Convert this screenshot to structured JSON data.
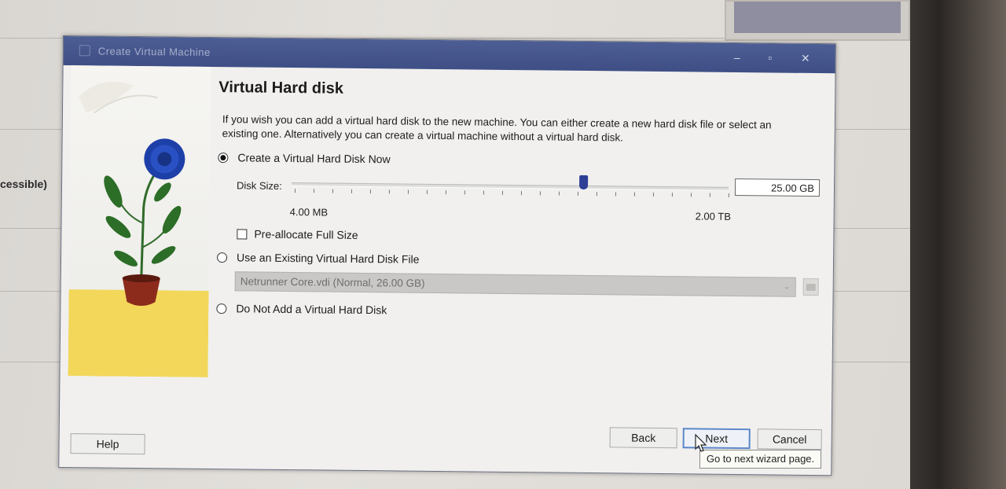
{
  "dialog": {
    "title": "Create Virtual Machine",
    "page_title": "Virtual Hard disk",
    "description": "If you wish you can add a virtual hard disk to the new machine. You can either create a new hard disk file or select an existing one. Alternatively you can create a virtual machine without a virtual hard disk."
  },
  "options": {
    "create_new": {
      "label": "Create a Virtual Hard Disk Now",
      "selected": true
    },
    "use_existing": {
      "label": "Use an Existing Virtual Hard Disk File",
      "selected": false
    },
    "do_not_add": {
      "label": "Do Not Add a Virtual Hard Disk",
      "selected": false
    }
  },
  "disk_size": {
    "label": "Disk Size:",
    "value": "25.00 GB",
    "min_label": "4.00 MB",
    "max_label": "2.00 TB"
  },
  "preallocate": {
    "label": "Pre-allocate Full Size",
    "checked": false
  },
  "existing_file": {
    "selected": "Netrunner Core.vdi (Normal, 26.00 GB)"
  },
  "buttons": {
    "help": "Help",
    "back": "Back",
    "next": "Next",
    "cancel": "Cancel"
  },
  "tooltip": "Go to next wizard page.",
  "background": {
    "left_text": "cessible)"
  }
}
